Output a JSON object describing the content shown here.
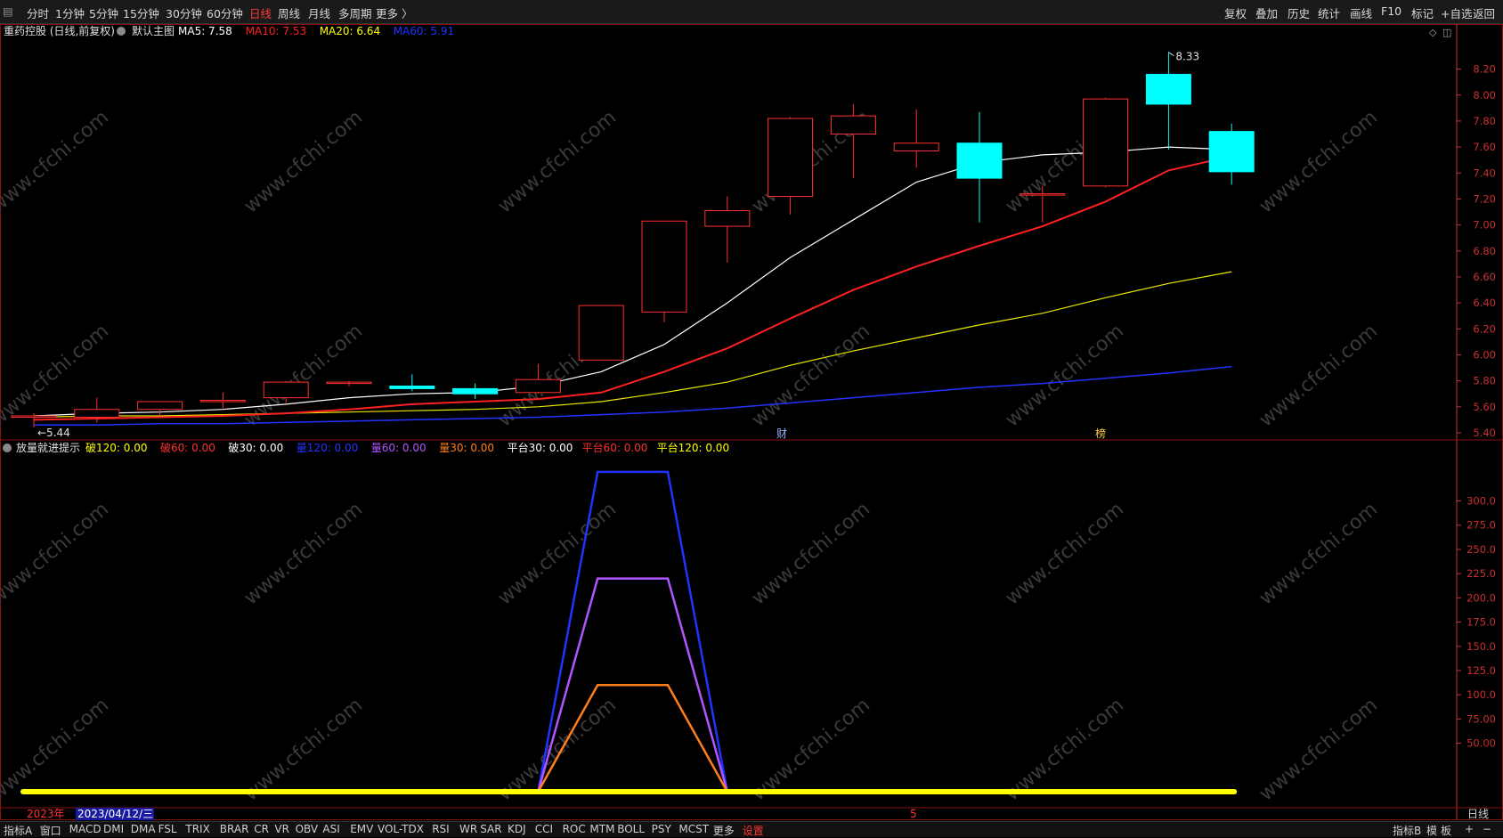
{
  "toolbar": {
    "left_items": [
      {
        "label": "分时",
        "active": false
      },
      {
        "label": "1分钟",
        "active": false
      },
      {
        "label": "5分钟",
        "active": false
      },
      {
        "label": "15分钟",
        "active": false
      },
      {
        "label": "30分钟",
        "active": false
      },
      {
        "label": "60分钟",
        "active": false
      },
      {
        "label": "日线",
        "active": true
      },
      {
        "label": "周线",
        "active": false
      },
      {
        "label": "月线",
        "active": false
      },
      {
        "label": "多周期",
        "active": false
      },
      {
        "label": "更多 〉",
        "active": false
      }
    ],
    "right_items": [
      "复权",
      "叠加",
      "历史",
      "统计",
      "画线",
      "F10",
      "标记",
      "+自选",
      "返回"
    ]
  },
  "main_panel": {
    "title": "重药控股 (日线,前复权)",
    "template": "默认主图",
    "ma": [
      {
        "label": "MA5: 7.58",
        "color": "#ffffff"
      },
      {
        "label": "MA10: 7.53",
        "color": "#ff2020"
      },
      {
        "label": "MA20: 6.64",
        "color": "#ffff00"
      },
      {
        "label": "MA60: 5.91",
        "color": "#2233ff"
      }
    ],
    "high_label": "8.33",
    "low_label": "5.44",
    "markers": [
      {
        "text": "财",
        "color": "#9ab0ff"
      },
      {
        "text": "榜",
        "color": "#ffcc44"
      }
    ]
  },
  "sub_panel": {
    "title": "放量就进提示",
    "items": [
      {
        "label": "破120: 0.00",
        "color": "#ffff00"
      },
      {
        "label": "破60: 0.00",
        "color": "#ff3030"
      },
      {
        "label": "破30: 0.00",
        "color": "#ffffff"
      },
      {
        "label": "量120: 0.00",
        "color": "#2233ff"
      },
      {
        "label": "量60: 0.00",
        "color": "#b055ff"
      },
      {
        "label": "量30: 0.00",
        "color": "#ff7f1a"
      },
      {
        "label": "平台30: 0.00",
        "color": "#ffffff"
      },
      {
        "label": "平台60: 0.00",
        "color": "#ff3030"
      },
      {
        "label": "平台120: 0.00",
        "color": "#ffff00"
      }
    ]
  },
  "chart_data": [
    {
      "type": "candlestick",
      "title": "重药控股 (日线,前复权)",
      "ylim": [
        5.4,
        8.3
      ],
      "yticks": [
        "8.20",
        "8.00",
        "7.80",
        "7.60",
        "7.40",
        "7.20",
        "7.00",
        "6.80",
        "6.60",
        "6.40",
        "6.20",
        "6.00",
        "5.80",
        "5.60",
        "5.40"
      ],
      "candles": [
        {
          "o": 5.53,
          "h": 5.55,
          "l": 5.44,
          "c": 5.53
        },
        {
          "o": 5.52,
          "h": 5.67,
          "l": 5.48,
          "c": 5.58
        },
        {
          "o": 5.58,
          "h": 5.64,
          "l": 5.53,
          "c": 5.64
        },
        {
          "o": 5.65,
          "h": 5.71,
          "l": 5.59,
          "c": 5.65
        },
        {
          "o": 5.67,
          "h": 5.8,
          "l": 5.63,
          "c": 5.79
        },
        {
          "o": 5.78,
          "h": 5.8,
          "l": 5.76,
          "c": 5.79
        },
        {
          "o": 5.76,
          "h": 5.85,
          "l": 5.72,
          "c": 5.74
        },
        {
          "o": 5.74,
          "h": 5.78,
          "l": 5.66,
          "c": 5.7
        },
        {
          "o": 5.71,
          "h": 5.93,
          "l": 5.7,
          "c": 5.81
        },
        {
          "o": 5.96,
          "h": 6.38,
          "l": 5.96,
          "c": 6.38
        },
        {
          "o": 6.33,
          "h": 7.03,
          "l": 6.25,
          "c": 7.03
        },
        {
          "o": 6.99,
          "h": 7.22,
          "l": 6.71,
          "c": 7.11
        },
        {
          "o": 7.22,
          "h": 7.83,
          "l": 7.08,
          "c": 7.82
        },
        {
          "o": 7.7,
          "h": 7.93,
          "l": 7.36,
          "c": 7.84
        },
        {
          "o": 7.57,
          "h": 7.89,
          "l": 7.44,
          "c": 7.63
        },
        {
          "o": 7.63,
          "h": 7.87,
          "l": 7.02,
          "c": 7.36
        },
        {
          "o": 7.24,
          "h": 7.3,
          "l": 7.02,
          "c": 7.24
        },
        {
          "o": 7.3,
          "h": 7.98,
          "l": 7.29,
          "c": 7.97
        },
        {
          "o": 8.16,
          "h": 8.33,
          "l": 7.58,
          "c": 7.93
        },
        {
          "o": 7.72,
          "h": 7.78,
          "l": 7.31,
          "c": 7.41
        }
      ],
      "ma5": [
        5.53,
        5.55,
        5.56,
        5.58,
        5.62,
        5.67,
        5.7,
        5.71,
        5.76,
        5.87,
        6.08,
        6.4,
        6.75,
        7.04,
        7.33,
        7.48,
        7.54,
        7.56,
        7.6,
        7.58
      ],
      "ma10": [
        5.5,
        5.51,
        5.52,
        5.53,
        5.55,
        5.58,
        5.62,
        5.64,
        5.66,
        5.71,
        5.87,
        6.05,
        6.28,
        6.5,
        6.68,
        6.84,
        6.99,
        7.18,
        7.42,
        7.53
      ],
      "ma20": [
        5.52,
        5.53,
        5.53,
        5.54,
        5.55,
        5.56,
        5.57,
        5.58,
        5.6,
        5.64,
        5.71,
        5.79,
        5.92,
        6.03,
        6.13,
        6.23,
        6.32,
        6.44,
        6.55,
        6.64
      ],
      "ma60": [
        5.46,
        5.46,
        5.47,
        5.47,
        5.48,
        5.49,
        5.5,
        5.51,
        5.52,
        5.54,
        5.56,
        5.59,
        5.63,
        5.67,
        5.71,
        5.75,
        5.78,
        5.82,
        5.86,
        5.91
      ]
    },
    {
      "type": "line",
      "title": "放量就进提示",
      "ylim": [
        0,
        340
      ],
      "yticks": [
        "300.0",
        "275.0",
        "250.0",
        "225.0",
        "200.0",
        "175.0",
        "150.0",
        "125.0",
        "100.0",
        "75.00",
        "50.00"
      ],
      "series": [
        {
          "name": "量120",
          "color": "#2233ff",
          "values": [
            0,
            0,
            0,
            0,
            0,
            0,
            0,
            0,
            0,
            330,
            330,
            0,
            0,
            0,
            0,
            0,
            0,
            0,
            0,
            0
          ]
        },
        {
          "name": "量60",
          "color": "#b055ff",
          "values": [
            0,
            0,
            0,
            0,
            0,
            0,
            0,
            0,
            0,
            220,
            220,
            0,
            0,
            0,
            0,
            0,
            0,
            0,
            0,
            0
          ]
        },
        {
          "name": "量30",
          "color": "#ff7f1a",
          "values": [
            0,
            0,
            0,
            0,
            0,
            0,
            0,
            0,
            0,
            110,
            110,
            0,
            0,
            0,
            0,
            0,
            0,
            0,
            0,
            0
          ]
        },
        {
          "name": "平台120",
          "color": "#ffff00",
          "values": [
            0,
            0,
            0,
            0,
            0,
            0,
            0,
            0,
            0,
            0,
            0,
            0,
            0,
            0,
            0,
            0,
            0,
            0,
            0,
            0
          ]
        }
      ]
    }
  ],
  "axis_bottom": {
    "year": "2023年",
    "date": "2023/04/12/三",
    "month_mark": "5",
    "period": "日线"
  },
  "bottom_tabs": [
    "指标A",
    "窗口",
    "MACD",
    "DMI",
    "DMA",
    "FSL",
    "TRIX",
    "BRAR",
    "CR",
    "VR",
    "OBV",
    "ASI",
    "EMV",
    "VOL-TDX",
    "RSI",
    "WR",
    "SAR",
    "KDJ",
    "CCI",
    "ROC",
    "MTM",
    "BOLL",
    "PSY",
    "MCST",
    "更多",
    "设置"
  ],
  "bottom_right": [
    "指标B",
    "模",
    "板",
    "+",
    "−"
  ],
  "watermark": "www.cfchi.com",
  "colors": {
    "up": "#ff3030",
    "down": "#00ffff",
    "grid": "#8a1010",
    "axis": "#c83030"
  }
}
